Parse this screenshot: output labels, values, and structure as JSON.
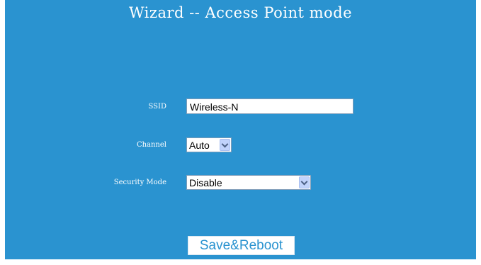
{
  "wizard": {
    "title": "Wizard -- Access Point mode"
  },
  "form": {
    "ssid": {
      "label": "SSID",
      "value": "Wireless-N"
    },
    "channel": {
      "label": "Channel",
      "selected": "Auto"
    },
    "security_mode": {
      "label": "Security Mode",
      "selected": "Disable"
    }
  },
  "actions": {
    "save_reboot_label": "Save&Reboot"
  },
  "colors": {
    "background": "#2a93d0",
    "text": "#ffffff",
    "button_text": "#2a93d0"
  },
  "icons": {
    "dropdown": "chevron-down-icon"
  }
}
